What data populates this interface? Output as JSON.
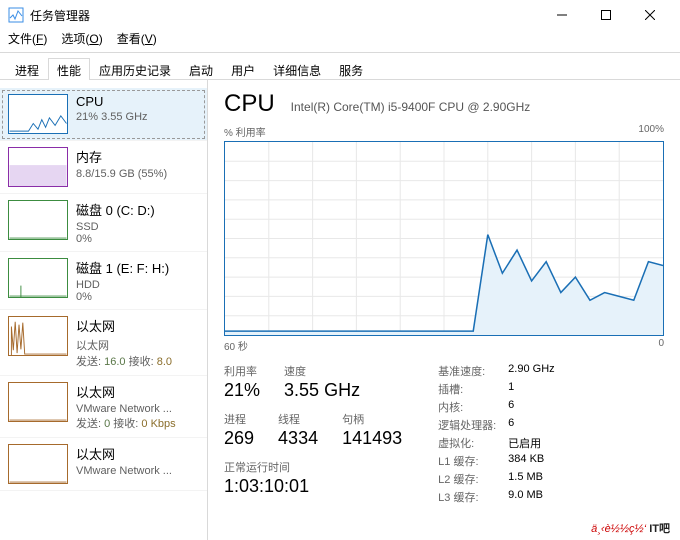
{
  "window": {
    "title": "任务管理器"
  },
  "menu": {
    "file": "文件(",
    "file_u": "F",
    "file_end": ")",
    "options": "选项(",
    "options_u": "O",
    "options_end": ")",
    "view": "查看(",
    "view_u": "V",
    "view_end": ")"
  },
  "tabs": [
    "进程",
    "性能",
    "应用历史记录",
    "启动",
    "用户",
    "详细信息",
    "服务"
  ],
  "active_tab": 1,
  "sidebar": [
    {
      "title": "CPU",
      "sub1": "21% 3.55 GHz"
    },
    {
      "title": "内存",
      "sub1": "8.8/15.9 GB (55%)"
    },
    {
      "title": "磁盘 0 (C: D:)",
      "sub1": "SSD",
      "sub2": "0%"
    },
    {
      "title": "磁盘 1 (E: F: H:)",
      "sub1": "HDD",
      "sub2": "0%"
    },
    {
      "title": "以太网",
      "sub1": "以太网",
      "sub2_pre": "发送: ",
      "sub2_send": "16.0",
      "sub2_mid": " 接收: ",
      "sub2_recv": "8.0"
    },
    {
      "title": "以太网",
      "sub1": "VMware Network ...",
      "sub2_pre": "发送: ",
      "sub2_send": "0",
      "sub2_mid": " 接收: ",
      "sub2_recv": "0 Kbps"
    },
    {
      "title": "以太网",
      "sub1": "VMware Network ..."
    }
  ],
  "main": {
    "title": "CPU",
    "desc": "Intel(R) Core(TM) i5-9400F CPU @ 2.90GHz",
    "chart_top_left": "% 利用率",
    "chart_top_right": "100%",
    "chart_bottom_left": "60 秒",
    "chart_bottom_right": "0",
    "stats": {
      "util_label": "利用率",
      "util": "21%",
      "speed_label": "速度",
      "speed": "3.55 GHz",
      "proc_label": "进程",
      "proc": "269",
      "threads_label": "线程",
      "threads": "4334",
      "handles_label": "句柄",
      "handles": "141493",
      "uptime_label": "正常运行时间",
      "uptime": "1:03:10:01"
    },
    "details": [
      {
        "k": "基准速度:",
        "v": "2.90 GHz"
      },
      {
        "k": "插槽:",
        "v": "1"
      },
      {
        "k": "内核:",
        "v": "6"
      },
      {
        "k": "逻辑处理器:",
        "v": "6"
      },
      {
        "k": "虚拟化:",
        "v": "已启用"
      },
      {
        "k": "L1 缓存:",
        "v": "384 KB"
      },
      {
        "k": "L2 缓存:",
        "v": "1.5 MB"
      },
      {
        "k": "L3 缓存:",
        "v": "9.0 MB"
      }
    ]
  },
  "watermark": {
    "a": "ä¸‹è½½ç½‘",
    "b": "IT吧"
  },
  "chart_data": {
    "type": "line",
    "title": "% 利用率",
    "ylabel": "",
    "ylim": [
      0,
      100
    ],
    "xlabel": "",
    "xlim": [
      60,
      0
    ],
    "x": [
      60,
      58,
      56,
      54,
      52,
      50,
      48,
      46,
      44,
      42,
      40,
      38,
      36,
      34,
      32,
      30,
      28,
      26,
      24,
      22,
      20,
      18,
      16,
      14,
      12,
      10,
      8,
      6,
      4,
      2,
      0
    ],
    "values": [
      2,
      2,
      2,
      2,
      2,
      2,
      2,
      2,
      2,
      2,
      2,
      2,
      2,
      2,
      2,
      2,
      2,
      2,
      52,
      32,
      44,
      28,
      38,
      22,
      30,
      18,
      22,
      20,
      18,
      38,
      36
    ]
  }
}
